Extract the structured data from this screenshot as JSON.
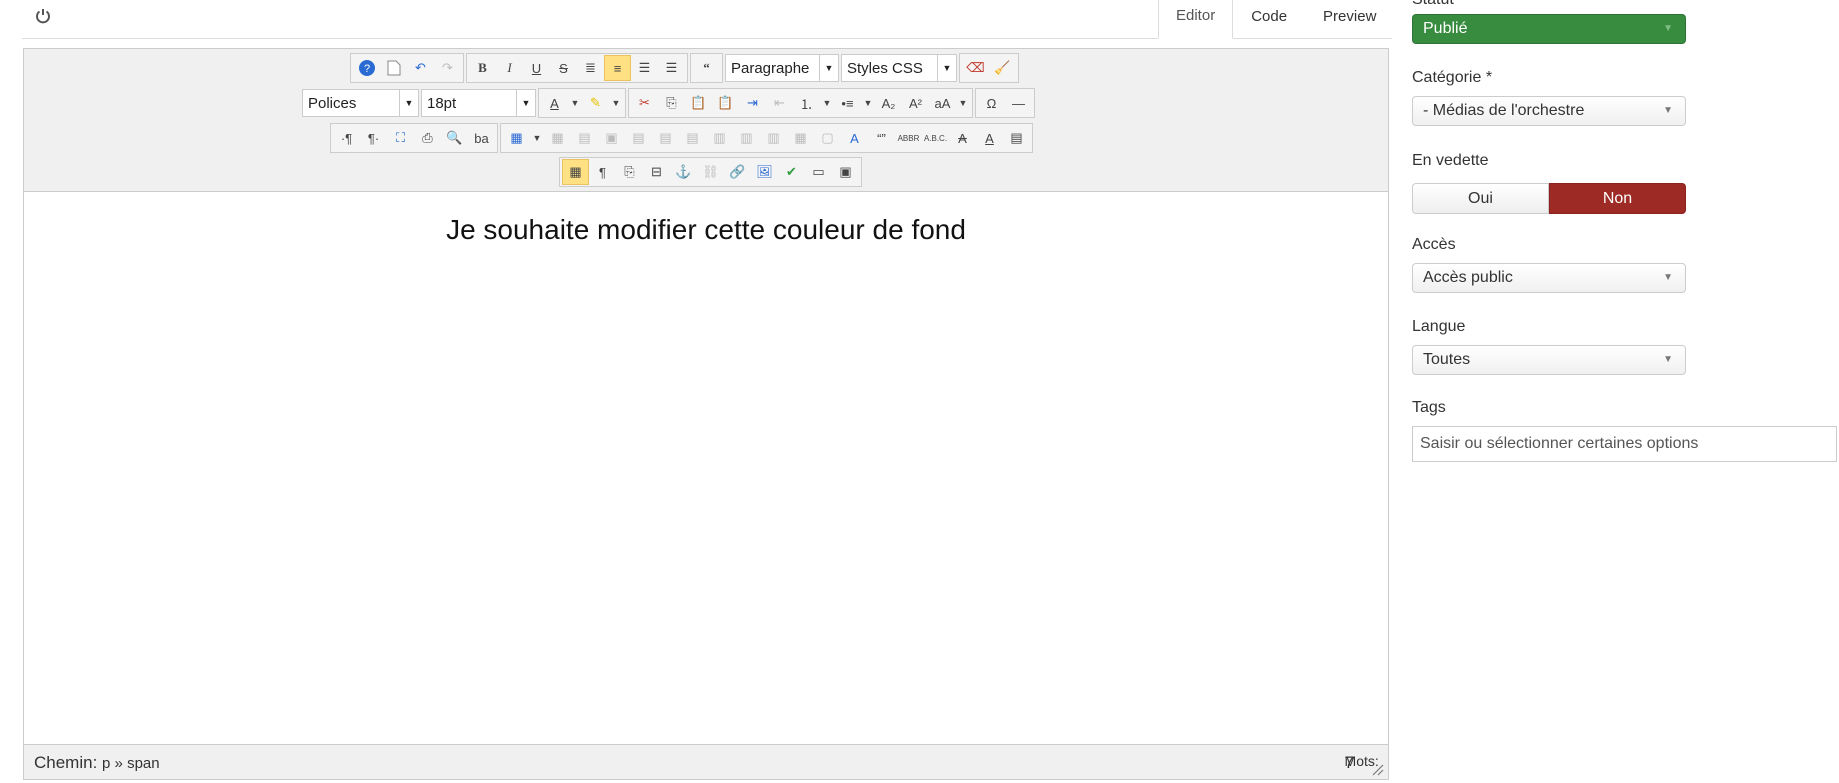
{
  "topbar": {
    "power_icon": "power-icon"
  },
  "tabs": [
    {
      "label": "Editor",
      "active": true
    },
    {
      "label": "Code",
      "active": false
    },
    {
      "label": "Preview",
      "active": false
    }
  ],
  "toolbar": {
    "format_select": "Paragraphe",
    "styles_select": "Styles CSS",
    "font_select": "Polices",
    "size_select": "18pt"
  },
  "content": {
    "text": "Je souhaite modifier cette couleur de fond"
  },
  "statusbar": {
    "path_label": "Chemin:",
    "path_value": "p » span",
    "words_label": "Mots:",
    "words_count": "7"
  },
  "panel": {
    "status_label": "Statut",
    "status_value": "Publié",
    "category_label": "Catégorie *",
    "category_value": "- Médias de l'orchestre",
    "featured_label": "En vedette",
    "featured_yes": "Oui",
    "featured_no": "Non",
    "access_label": "Accès",
    "access_value": "Accès public",
    "language_label": "Langue",
    "language_value": "Toutes",
    "tags_label": "Tags",
    "tags_placeholder": "Saisir ou sélectionner certaines options"
  },
  "colors": {
    "status_green": "#378c3f",
    "non_red": "#9d2a24",
    "active_button": "#ffe184"
  }
}
